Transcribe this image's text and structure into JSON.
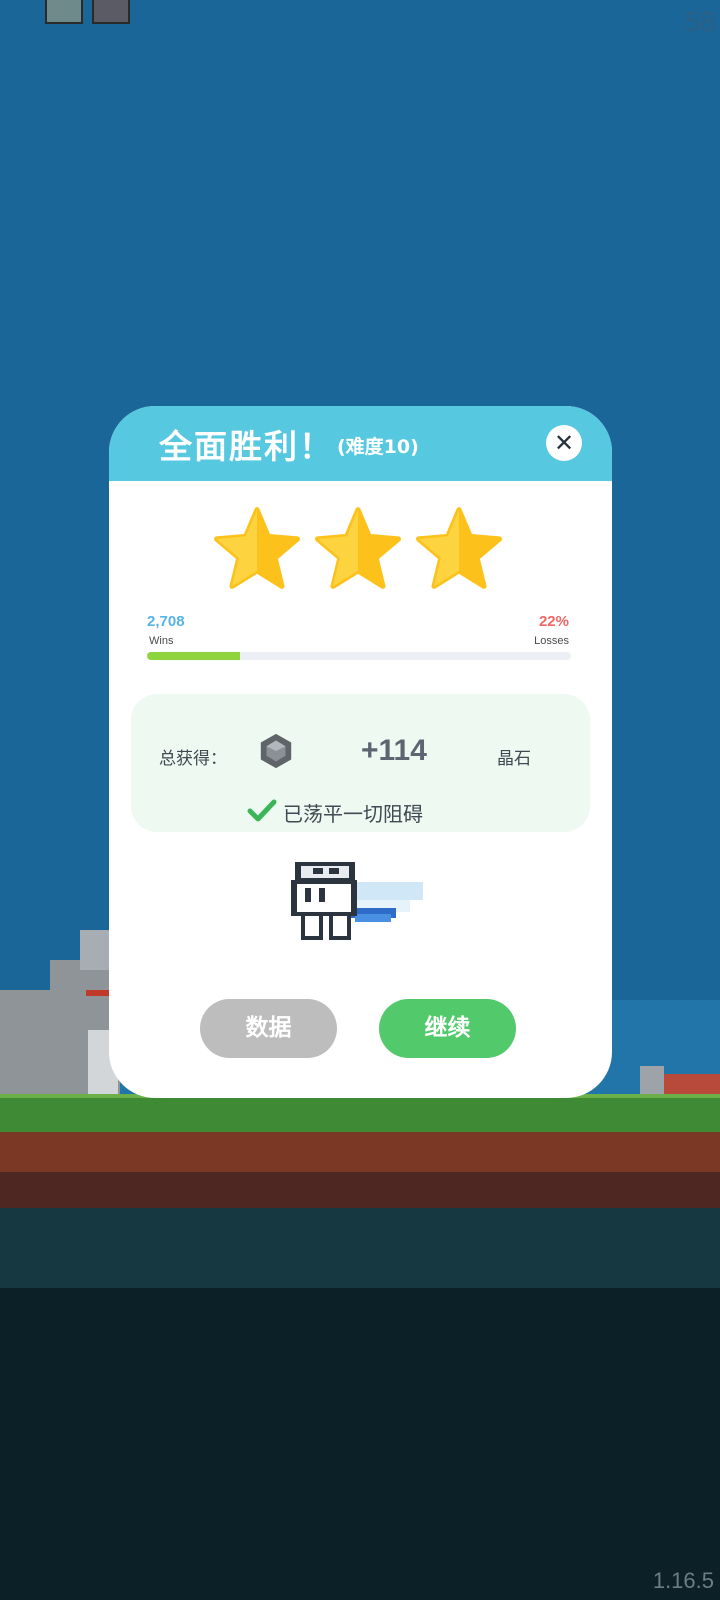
{
  "hud": {
    "fps": "58",
    "version": "1.16.5"
  },
  "dialog": {
    "title": "全面胜利！",
    "subtitle": "(难度10)",
    "close_label": "✕",
    "stars": 3,
    "stats": {
      "wins_value": "2,708",
      "wins_label": "Wins",
      "losses_value": "22%",
      "losses_label": "Losses",
      "win_fraction": 0.22
    },
    "reward": {
      "label": "总获得：",
      "amount": "+114",
      "currency": "晶石",
      "gem_icon": "gem-icon"
    },
    "status_text": "已荡平一切阻碍",
    "buttons": {
      "data": "数据",
      "continue": "继续"
    }
  },
  "colors": {
    "header": "#56c8df",
    "continue": "#52c96b",
    "data_button": "#bdbdbd",
    "wins": "#56b3e6",
    "losses": "#ef6767",
    "progress": "#8fd43d",
    "star": "#fcc21b"
  }
}
